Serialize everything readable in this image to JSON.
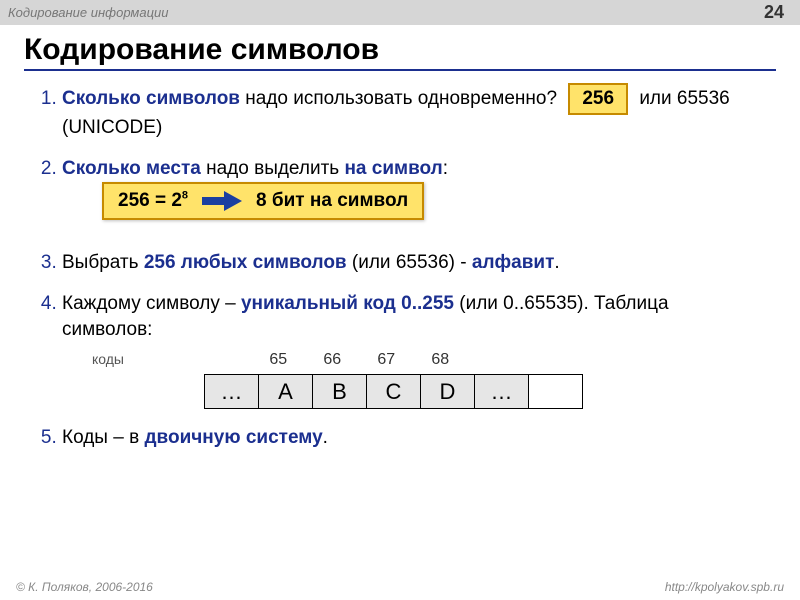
{
  "header": {
    "breadcrumb": "Кодирование информации",
    "page_number": "24"
  },
  "title": "Кодирование символов",
  "items": {
    "i1": {
      "lead": "Сколько символов",
      "rest1": " надо использовать одновременно?",
      "badge": "256",
      "rest2": "или 65536 (UNICODE)"
    },
    "i2": {
      "lead": "Сколько места",
      "rest1": " надо выделить ",
      "emph": "на символ",
      "rest2": ":",
      "formula_lhs": "256 = 2",
      "formula_exp": "8",
      "formula_rhs": "8 бит на символ"
    },
    "i3": {
      "rest1": "Выбрать ",
      "emph1": "256 любых символов",
      "rest2": " (или 65536) - ",
      "emph2": "алфавит",
      "rest3": "."
    },
    "i4": {
      "rest1": "Каждому символу – ",
      "emph": "уникальный код 0..255",
      "rest2": " (или 0..65535). Таблица символов:"
    },
    "table": {
      "label": "коды",
      "nums": {
        "n0": "65",
        "n1": "66",
        "n2": "67",
        "n3": "68"
      },
      "cells": {
        "c0": "…",
        "c1": "A",
        "c2": "B",
        "c3": "C",
        "c4": "D",
        "c5": "…",
        "c6": ""
      }
    },
    "i5": {
      "rest1": "Коды – в ",
      "emph": "двоичную систему",
      "rest2": "."
    }
  },
  "footer": {
    "left": "© К. Поляков, 2006-2016",
    "right": "http://kpolyakov.spb.ru"
  }
}
